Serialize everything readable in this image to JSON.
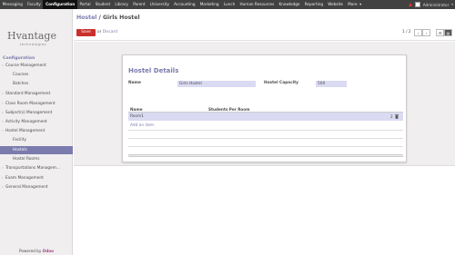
{
  "topbar": {
    "menu": [
      "Messaging",
      "Faculty",
      "Configuration",
      "Portal",
      "Student",
      "Library",
      "Parent",
      "University",
      "Accounting",
      "Marketing",
      "Lunch",
      "Human Resources",
      "Knowledge",
      "Reporting",
      "Website",
      "More"
    ],
    "active_index": 2,
    "user": "Administrator",
    "alert_color": "#e0342a"
  },
  "logo": {
    "name": "Hvantage",
    "tagline": "technologies"
  },
  "sidebar": {
    "section_title": "Configuration",
    "items": [
      {
        "label": "Course Management",
        "level": 0,
        "expandable": true
      },
      {
        "label": "Courses",
        "level": 1
      },
      {
        "label": "Batches",
        "level": 1
      },
      {
        "label": "Standard Management",
        "level": 0,
        "expandable": true
      },
      {
        "label": "Class Room Management",
        "level": 0,
        "expandable": true
      },
      {
        "label": "Subject(s) Management",
        "level": 0,
        "expandable": true
      },
      {
        "label": "Activity Management",
        "level": 0,
        "expandable": true
      },
      {
        "label": "Hostel Management",
        "level": 0,
        "expandable": true
      },
      {
        "label": "Facility",
        "level": 1
      },
      {
        "label": "Hostels",
        "level": 1,
        "active": true
      },
      {
        "label": "Hostel Rooms",
        "level": 1
      },
      {
        "label": "Transportations Managem...",
        "level": 0,
        "expandable": true
      },
      {
        "label": "Exam Management",
        "level": 0,
        "expandable": true
      },
      {
        "label": "General Management",
        "level": 0,
        "expandable": true
      }
    ],
    "powered_prefix": "Powered by",
    "powered_brand": "Odoo"
  },
  "control": {
    "breadcrumb_parent": "Hostel",
    "breadcrumb_sep": "/",
    "breadcrumb_current": "Girls Hostel",
    "save_label": "Save",
    "or_text": "or",
    "discard_label": "Discard",
    "pager": "1 / 2",
    "prev_icon": "‹",
    "next_icon": "›",
    "list_icon": "☰",
    "form_icon": "▤"
  },
  "form": {
    "title": "Hostel Details",
    "name_label": "Name",
    "name_value": "Girls Hostel",
    "capacity_label": "Hostel Capacity",
    "capacity_value": "500",
    "table": {
      "columns": [
        "Name",
        "Students Per Room"
      ],
      "rows": [
        {
          "name": "Room1",
          "students_per_room": "2"
        }
      ],
      "add_item_label": "Add an item"
    }
  },
  "colors": {
    "accent": "#7c7bad",
    "save": "#c9302c",
    "topbar": "#414141",
    "input_bg": "#dadaf2"
  }
}
